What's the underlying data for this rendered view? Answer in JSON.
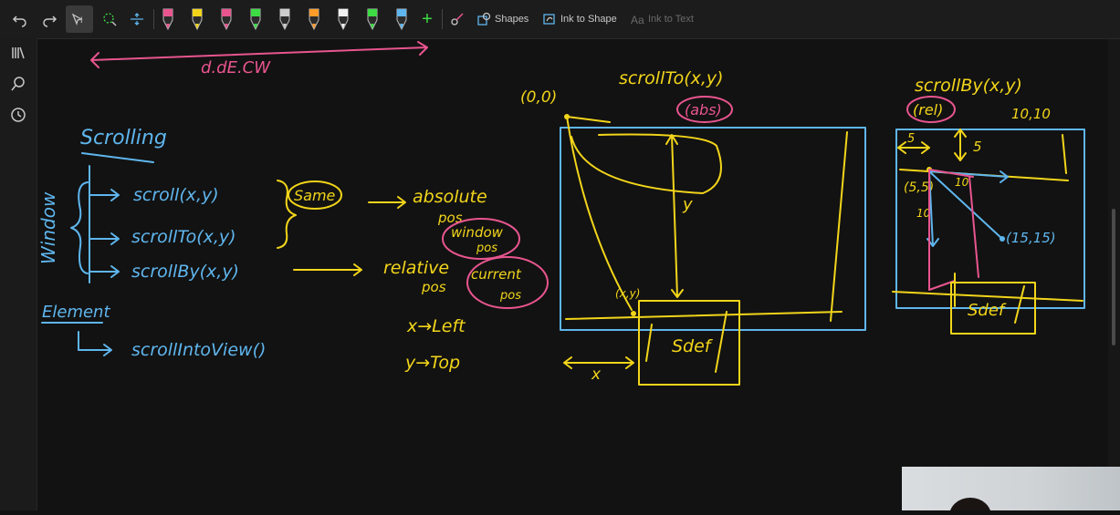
{
  "toolbar": {
    "shapes_label": "Shapes",
    "ink_to_shape_label": "Ink to Shape",
    "ink_to_text_label": "Ink to Text",
    "pen_colors": [
      "#e8558f",
      "#f2d51a",
      "#e8558f",
      "#3ddc45",
      "#cccccc",
      "#ff9c2a",
      "#f0f0f0",
      "#3ddc45",
      "#5fb6ee"
    ]
  },
  "sidebar": {
    "icons": [
      "library-icon",
      "search-icon",
      "history-icon"
    ]
  },
  "canvas": {
    "top_label": "d.dE.CW",
    "scrolling_heading": "Scrolling",
    "window_label": "Window",
    "method_scroll": "scroll(x,y)",
    "method_scrollto": "scrollTo(x,y)",
    "method_scrollby": "scrollBy(x,y)",
    "same_label": "Same",
    "absolute_label": "absolute",
    "pos_label_1": "pos",
    "window_pos_label": "window",
    "window_pos_sub": "pos",
    "relative_label": "relative",
    "pos_label_2": "pos",
    "current_label": "current",
    "current_sub": "pos",
    "x_left": "x→Left",
    "y_top": "y→Top",
    "element_label": "Element",
    "scroll_into_view": "scrollIntoView()",
    "origin_label": "(0,0)",
    "scrollto_title": "scrollTo(x,y)",
    "abs_label": "(abs)",
    "y_axis_label": "y",
    "xy_point_label": "(x,y)",
    "x_axis_label": "x",
    "sdef_label_1": "Sdef",
    "scrollby_title": "scrollBy(x,y)",
    "rel_label": "(rel)",
    "ten_ten_label": "10,10",
    "five_label_1": "5",
    "five_label_2": "5",
    "five_five_label": "(5,5)",
    "ten_label_1": "10",
    "ten_label_2": "10",
    "fifteen_label": "(15,15)",
    "sdef_label_2": "Sdef"
  }
}
